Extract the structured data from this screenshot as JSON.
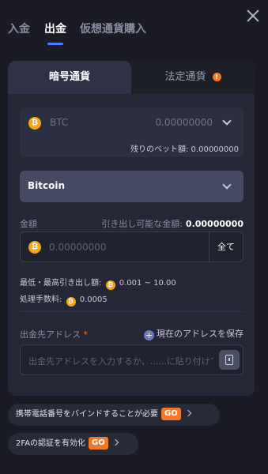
{
  "tabs": [
    {
      "label": "入金"
    },
    {
      "label": "出金"
    },
    {
      "label": "仮想通貨購入"
    }
  ],
  "segment": {
    "crypto_label": "暗号通貨",
    "fiat_label": "法定通貨",
    "fiat_badge": "!"
  },
  "currency_select": {
    "coin_symbol": "₿",
    "name": "BTC",
    "amount": "0.00000000",
    "balance_text": "残りのベット額: 0.00000000"
  },
  "network_select": {
    "label": "Bitcoin"
  },
  "amount": {
    "label": "金額",
    "available_label": "引き出し可能な金額:",
    "available_value": "0.00000000",
    "placeholder": "0.00000000",
    "all_button": "全て"
  },
  "limits": {
    "min_max_label": "最低・最高引き出し額:",
    "min_max_value": "0.001 ~ 10.00",
    "fee_label": "処理手数料:",
    "fee_value": "0.0005"
  },
  "address": {
    "label": "出金先アドレス",
    "required_mark": "*",
    "save_label": "現在のアドレスを保存",
    "placeholder": "出金先アドレスを入力するか、......に貼り付けてください"
  },
  "prompts": {
    "phone_text": "携帯電話番号をバインドすることが必要",
    "twofa_text": "2FAの認証を有効化",
    "go_label": "GO"
  },
  "colors": {
    "accent": "#4e7bff",
    "go": "#f07a2a",
    "coin": "#f7a41d"
  }
}
